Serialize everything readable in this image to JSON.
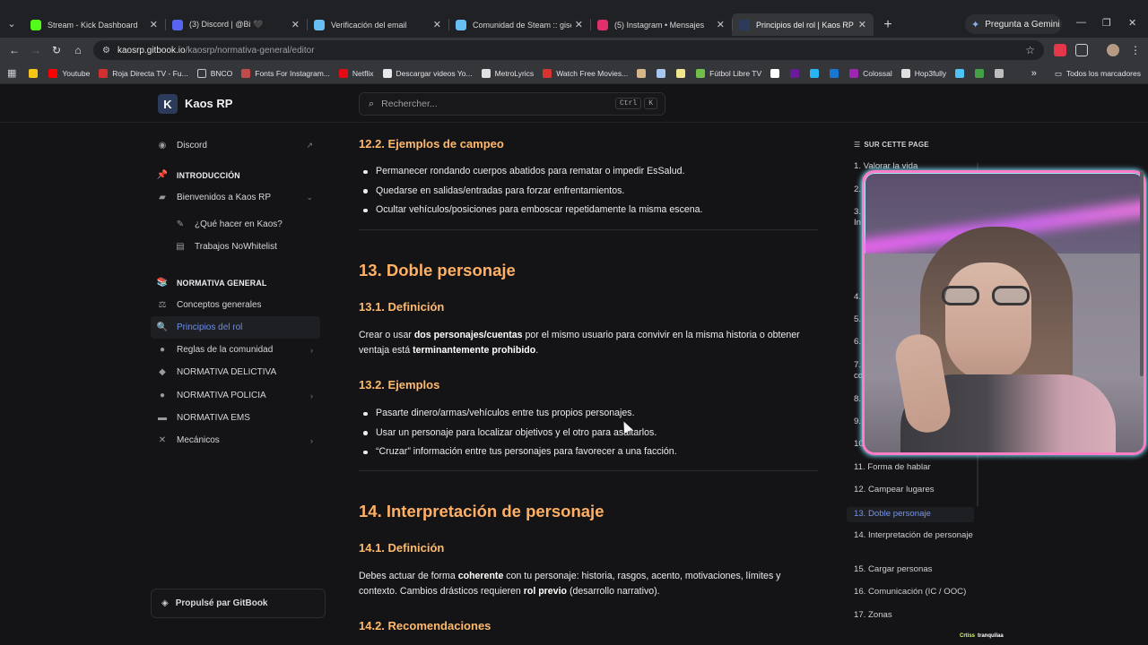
{
  "browser": {
    "tabs": [
      {
        "title": "Stream - Kick Dashboard",
        "color": "#53fc18"
      },
      {
        "title": "(3) Discord | @Bi 🖤",
        "color": "#5865f2"
      },
      {
        "title": "Verificación del email",
        "color": "#66c0f4"
      },
      {
        "title": "Comunidad de Steam :: giselma",
        "color": "#66c0f4"
      },
      {
        "title": "(5) Instagram • Mensajes",
        "color": "#e1306c"
      },
      {
        "title": "Principios del rol | Kaos RP",
        "color": "#2c3a5c",
        "active": true
      }
    ],
    "gemini_label": "Pregunta a Gemini",
    "url_host": "kaosrp.gitbook.io",
    "url_path": "/kaosrp/normativa-general/editor",
    "bookmarks": [
      {
        "label": "",
        "color": "#f5c518"
      },
      {
        "label": "Youtube",
        "color": "#ff0000"
      },
      {
        "label": "Roja Directa TV - Fu...",
        "color": "#d32f2f"
      },
      {
        "label": "BNCO",
        "color": "#c7c7cb"
      },
      {
        "label": "Fonts For Instagram...",
        "color": "#c14a4a"
      },
      {
        "label": "Netflix",
        "color": "#e50914"
      },
      {
        "label": "Descargar videos Yo...",
        "color": "#e8e8ea"
      },
      {
        "label": "MetroLyrics",
        "color": "#e1e1e4"
      },
      {
        "label": "Watch Free Movies...",
        "color": "#d8342f"
      },
      {
        "label": "",
        "color": "#d7b68a"
      },
      {
        "label": "",
        "color": "#a7c7f2"
      },
      {
        "label": "",
        "color": "#f0e68c"
      },
      {
        "label": "Fútbol Libre TV",
        "color": "#6fbf4a"
      },
      {
        "label": "",
        "color": "#ffffff"
      },
      {
        "label": "",
        "color": "#6a1b9a"
      },
      {
        "label": "",
        "color": "#29b6f6"
      },
      {
        "label": "",
        "color": "#1976d2"
      },
      {
        "label": "Colossal",
        "color": "#9c27b0"
      },
      {
        "label": "Hop3fully",
        "color": "#e0e0e0"
      },
      {
        "label": "",
        "color": "#4fc3f7"
      },
      {
        "label": "",
        "color": "#43a047"
      },
      {
        "label": "",
        "color": "#bdbdbd"
      }
    ],
    "all_bookmarks": "Todos los marcadores"
  },
  "site": {
    "logo_letter": "K",
    "name": "Kaos RP",
    "search_placeholder": "Rechercher...",
    "shortcut": [
      "Ctrl",
      "K"
    ],
    "powered_by": "Propulsé par GitBook"
  },
  "sidebar": [
    {
      "label": "Discord",
      "icon": "discord-icon",
      "glyph": "◉",
      "type": "link",
      "arrow": "↗"
    },
    {
      "label": "INTRODUCCIÓN",
      "icon": "pin-icon",
      "glyph": "📌",
      "type": "section"
    },
    {
      "label": "Bienvenidos a Kaos RP",
      "icon": "book-icon",
      "glyph": "▰",
      "type": "item",
      "arrow": "⌄"
    },
    {
      "label": "¿Qué hacer en Kaos?",
      "icon": "note-icon",
      "glyph": "✎",
      "type": "sub"
    },
    {
      "label": "Trabajos NoWhitelist",
      "icon": "doc-icon",
      "glyph": "▤",
      "type": "sub"
    },
    {
      "label": "NORMATIVA GENERAL",
      "icon": "books-icon",
      "glyph": "📚",
      "type": "section"
    },
    {
      "label": "Conceptos generales",
      "icon": "scale-icon",
      "glyph": "⚖",
      "type": "item"
    },
    {
      "label": "Principios del rol",
      "icon": "magnifier-icon",
      "glyph": "🔍",
      "type": "item",
      "active": true
    },
    {
      "label": "Reglas de la comunidad",
      "icon": "globe-icon",
      "glyph": "●",
      "type": "item",
      "arrow": "›"
    },
    {
      "label": "NORMATIVA DELICTIVA",
      "icon": "mask-icon",
      "glyph": "◆",
      "type": "item"
    },
    {
      "label": "NORMATIVA POLICIA",
      "icon": "police-icon",
      "glyph": "●",
      "type": "item",
      "arrow": "›"
    },
    {
      "label": "NORMATIVA EMS",
      "icon": "ambulance-icon",
      "glyph": "▬",
      "type": "item"
    },
    {
      "label": "Mecánicos",
      "icon": "tools-icon",
      "glyph": "✕",
      "type": "item",
      "arrow": "›"
    }
  ],
  "content": {
    "s12_2_title": "12.2. Ejemplos de campeo",
    "s12_2_items": [
      "Permanecer rondando cuerpos abatidos para rematar o impedir EsSalud.",
      "Quedarse en salidas/entradas para forzar enfrentamientos.",
      "Ocultar vehículos/posiciones para emboscar repetidamente la misma escena."
    ],
    "s13_title": "13. Doble personaje",
    "s13_1_title": "13.1. Definición",
    "s13_1_text": {
      "a": "Crear o usar ",
      "b": "dos personajes/cuentas",
      "c": " por el mismo usuario para convivir en la misma historia o obtener ventaja está ",
      "d": "terminantemente prohibido",
      "e": "."
    },
    "s13_2_title": "13.2. Ejemplos",
    "s13_2_items": [
      "Pasarte dinero/armas/vehículos entre tus propios personajes.",
      "Usar un personaje para localizar objetivos y el otro para asaltarlos.",
      "“Cruzar” información entre tus personajes para favorecer a una facción."
    ],
    "s14_title": "14. Interpretación de personaje",
    "s14_1_title": "14.1. Definición",
    "s14_1_text": {
      "a": "Debes actuar de forma ",
      "b": "coherente",
      "c": " con tu personaje: historia, rasgos, acento, motivaciones, límites y contexto. Cambios drásticos requieren ",
      "d": "rol previo",
      "e": " (desarrollo narrativo)."
    },
    "s14_2_title": "14.2. Recomendaciones"
  },
  "toc": {
    "title": "SUR CETTE PAGE",
    "items": [
      {
        "label": "1. Valorar la vida"
      },
      {
        "label": "2."
      },
      {
        "label": "3."
      },
      {
        "label": "In"
      },
      {
        "label": "4."
      },
      {
        "label": "5."
      },
      {
        "label": "6."
      },
      {
        "label": "7."
      },
      {
        "label": "co"
      },
      {
        "label": "8."
      },
      {
        "label": "9."
      },
      {
        "label": "10"
      },
      {
        "label": "11. Forma de hablar"
      },
      {
        "label": "12. Campear lugares"
      },
      {
        "label": "13. Doble personaje",
        "active": true
      },
      {
        "label": "14. Interpretación de personaje"
      },
      {
        "label": "15. Cargar personas"
      },
      {
        "label": "16. Comunicación (IC / OOC)"
      },
      {
        "label": "17. Zonas"
      }
    ]
  },
  "overlay": {
    "tag": "Crtiss",
    "tag2": "tranquilaa"
  }
}
